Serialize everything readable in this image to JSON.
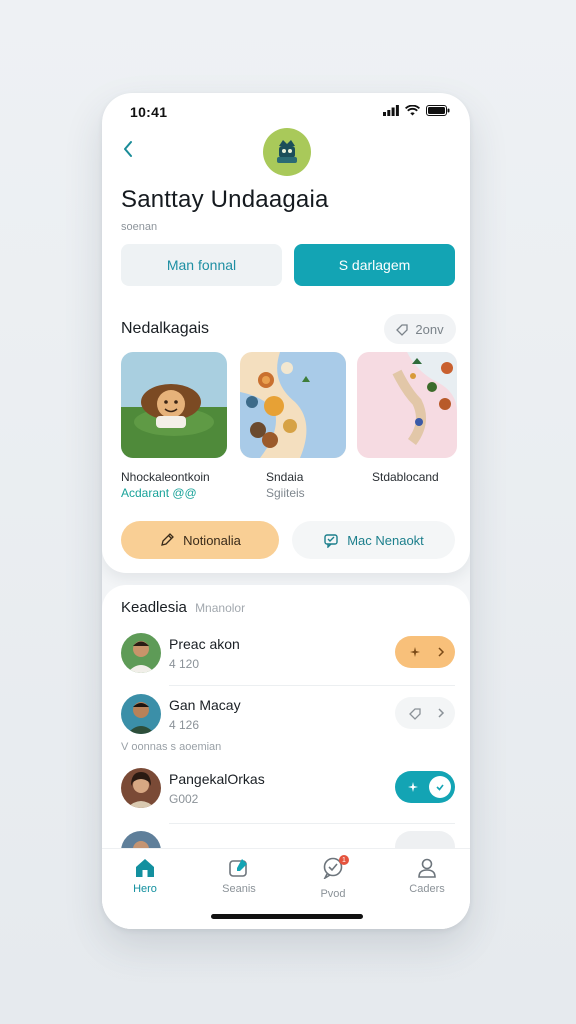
{
  "status_bar": {
    "time": "10:41"
  },
  "header": {
    "title": "Santtay Undaagaia",
    "subtitle": "soenan",
    "primary_buttons": [
      {
        "label": "Man fonnal"
      },
      {
        "label": "S darlagem"
      }
    ]
  },
  "section": {
    "title": "Nedalkagais",
    "chip_label": "2onv",
    "tiles": [
      {
        "label": "Nhockaleontkoin",
        "sub": "Acdarant @@",
        "sub_color": "#1aa39a"
      },
      {
        "label": "Sndaia",
        "sub": "Sgiiteis",
        "sub_color": "#7f878e"
      },
      {
        "label": "Stdablocand",
        "sub": "",
        "sub_color": "#7f878e"
      }
    ],
    "pills": [
      {
        "label": "Notionalia"
      },
      {
        "label": "Mac Nenaokt"
      }
    ]
  },
  "contacts": {
    "heading": "Keadlesia",
    "heading_muted": "Mnanolor",
    "group_label": "V oonnas s aoemian",
    "rows": [
      {
        "name": "Preac akon",
        "num": "4 120",
        "action_style": "orange"
      },
      {
        "name": "Gan Macay",
        "num": "4 126",
        "action_style": "grey"
      },
      {
        "name": "PangekalOrkas",
        "num": "G002",
        "action_style": "teal"
      }
    ]
  },
  "tabbar": {
    "tabs": [
      {
        "label": "Hero",
        "icon": "home-icon",
        "active": true
      },
      {
        "label": "Seanis",
        "icon": "search-edit-icon",
        "active": false
      },
      {
        "label": "Pvod",
        "icon": "chat-icon",
        "active": false,
        "badge": "1"
      },
      {
        "label": "Caders",
        "icon": "profile-icon",
        "active": false
      }
    ]
  },
  "colors": {
    "accent_teal": "#13a4b4",
    "accent_orange": "#f9cf95",
    "badge_red": "#e5533d"
  }
}
